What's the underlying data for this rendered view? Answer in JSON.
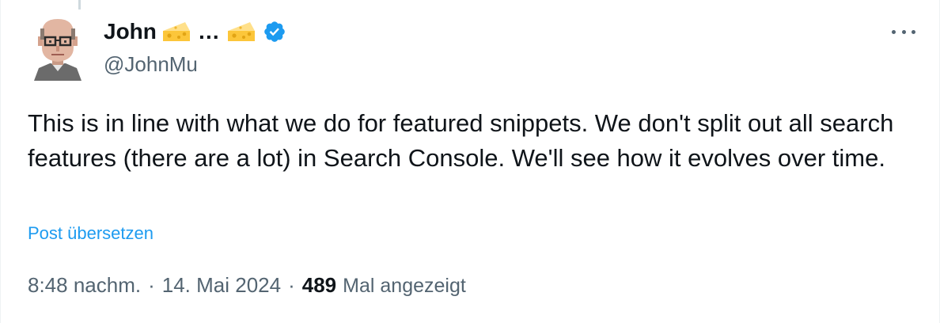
{
  "author": {
    "display_name": "John",
    "name_ellipsis": "…",
    "handle": "@JohnMu",
    "emoji_icon": "cheese-wedge-icon",
    "verified_icon": "verified-badge-icon",
    "verified_color": "#1d9bf0"
  },
  "tweet": {
    "text": "This is in line with what we do for featured snippets. We don't split out all search features (there are a lot) in Search Console. We'll see how it evolves over time.",
    "translate_label": "Post übersetzen"
  },
  "meta": {
    "time": "8:48 nachm.",
    "separator": "·",
    "date": "14. Mai 2024",
    "views_count": "489",
    "views_label": "Mal angezeigt"
  },
  "colors": {
    "text": "#0f1419",
    "secondary": "#536471",
    "accent": "#1d9bf0"
  }
}
